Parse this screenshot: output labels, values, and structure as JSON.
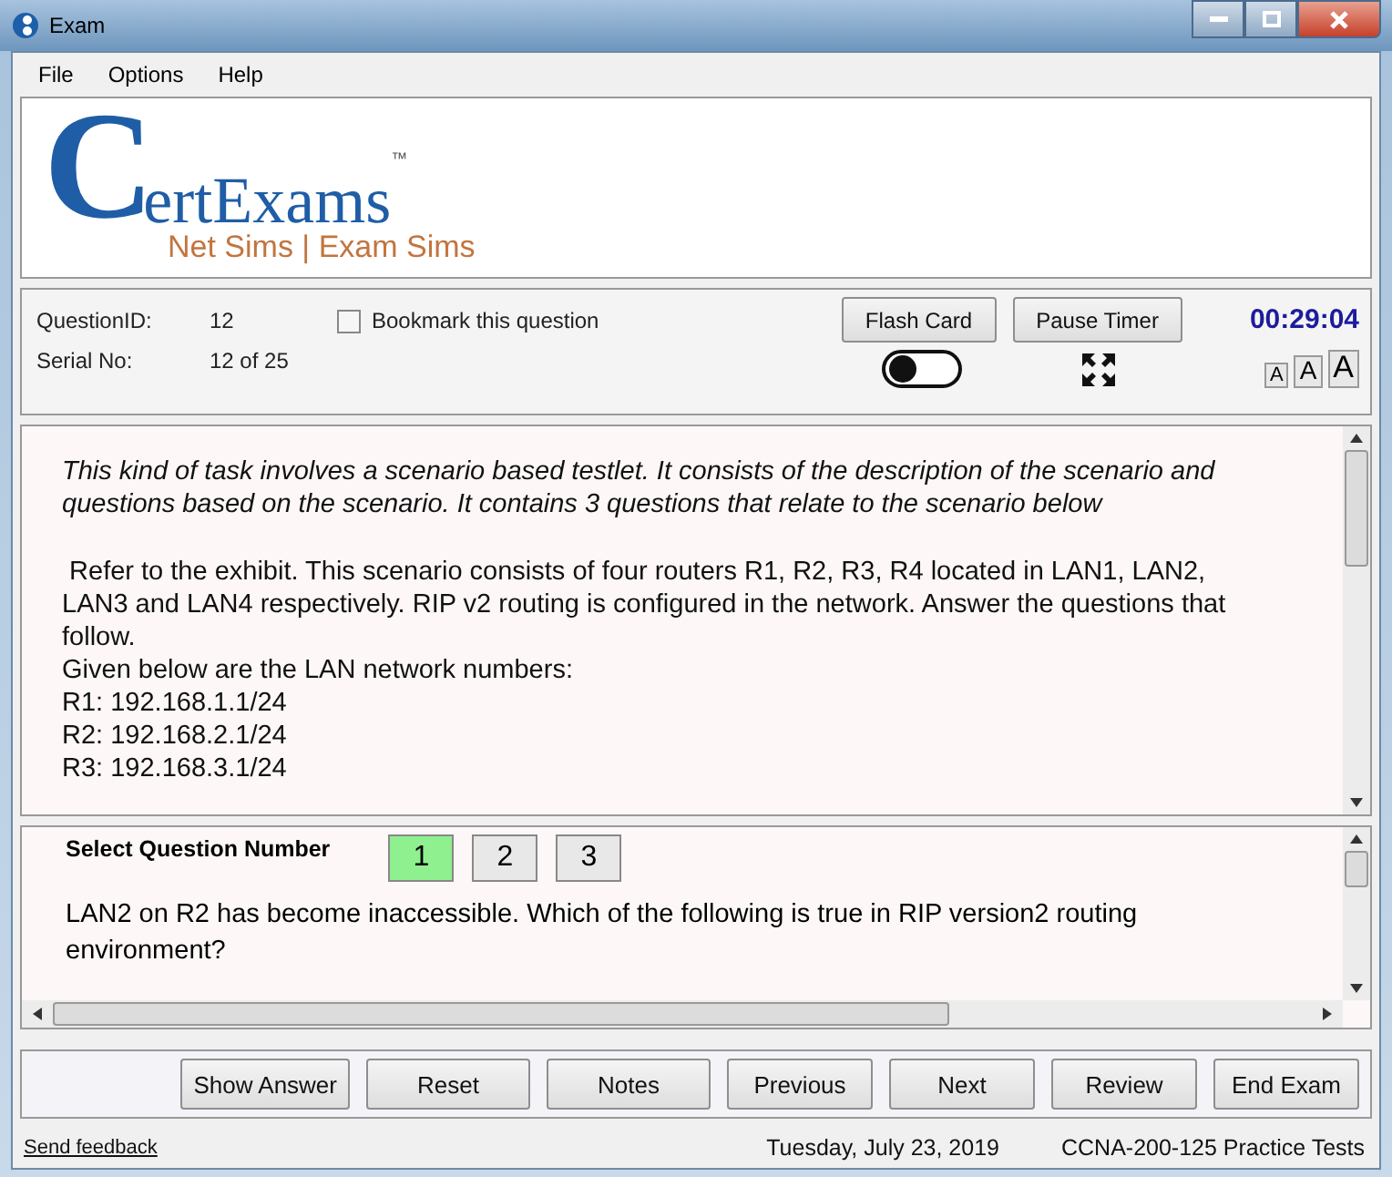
{
  "window": {
    "title": "Exam"
  },
  "menu": [
    "File",
    "Options",
    "Help"
  ],
  "logo": {
    "initial": "C",
    "name": "ertExams",
    "trademark": "™",
    "tagline": "Net Sims | Exam Sims"
  },
  "info": {
    "question_id_label": "QuestionID:",
    "question_id": "12",
    "serial_label": "Serial No:",
    "serial": "12 of 25",
    "bookmark": {
      "label": "Bookmark this question",
      "checked": false
    }
  },
  "top_buttons": [
    "Flash Card",
    "Pause Timer"
  ],
  "timer": "00:29:04",
  "theme_toggle": {
    "on": false
  },
  "font_sizes": [
    "A",
    "A",
    "A"
  ],
  "scenario": {
    "intro": "This kind of task involves a scenario based testlet. It consists of the description of the scenario and questions based on the scenario. It contains 3 questions that relate to the scenario below",
    "lines": [
      " Refer to the exhibit. This scenario consists of four routers R1, R2, R3, R4 located in LAN1, LAN2, LAN3 and LAN4 respectively. RIP v2 routing is configured in the network. Answer the questions that follow.",
      "Given below are the LAN network numbers:",
      "R1: 192.168.1.1/24",
      "R2: 192.168.2.1/24",
      "R3: 192.168.3.1/24"
    ]
  },
  "question": {
    "select_label": "Select Question Number",
    "numbers": [
      {
        "label": "1",
        "selected": true
      },
      {
        "label": "2",
        "selected": false
      },
      {
        "label": "3",
        "selected": false
      }
    ],
    "text": "LAN2 on R2 has become inaccessible. Which of the following is true in RIP version2 routing environment?"
  },
  "bottom_buttons": [
    "Show Answer",
    "Reset",
    "Notes",
    "Previous",
    "Next",
    "Review",
    "End Exam"
  ],
  "status_bar": {
    "link": "Send feedback",
    "date": "Tuesday, July 23, 2019",
    "product": "CCNA-200-125 Practice Tests"
  }
}
